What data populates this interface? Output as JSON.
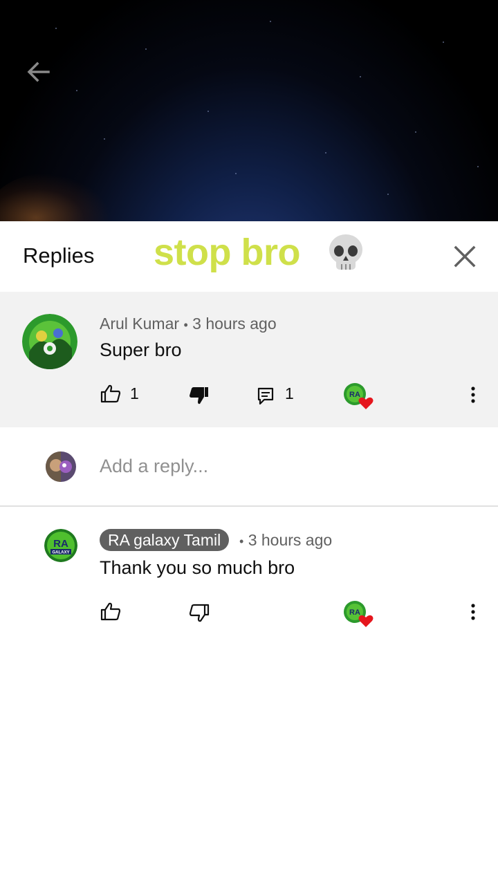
{
  "header": {
    "title": "Replies",
    "overlay_text": "stop bro"
  },
  "parent_comment": {
    "author": "Arul Kumar",
    "separator": "•",
    "time": "3 hours ago",
    "text": "Super bro",
    "likes": "1",
    "replies": "1"
  },
  "reply_box": {
    "placeholder": "Add a reply..."
  },
  "reply": {
    "author": "RA galaxy Tamil",
    "separator": "•",
    "time": "3 hours ago",
    "text": "Thank you so much bro"
  },
  "colors": {
    "overlay_text": "#cfe04a",
    "heart": "#e5161d",
    "owner_badge": "#606060"
  },
  "icons": [
    "back-arrow-icon",
    "skull-emoji-icon",
    "close-icon",
    "thumbs-up-icon",
    "thumbs-down-icon",
    "reply-comment-icon",
    "creator-heart-icon",
    "more-vert-icon"
  ]
}
